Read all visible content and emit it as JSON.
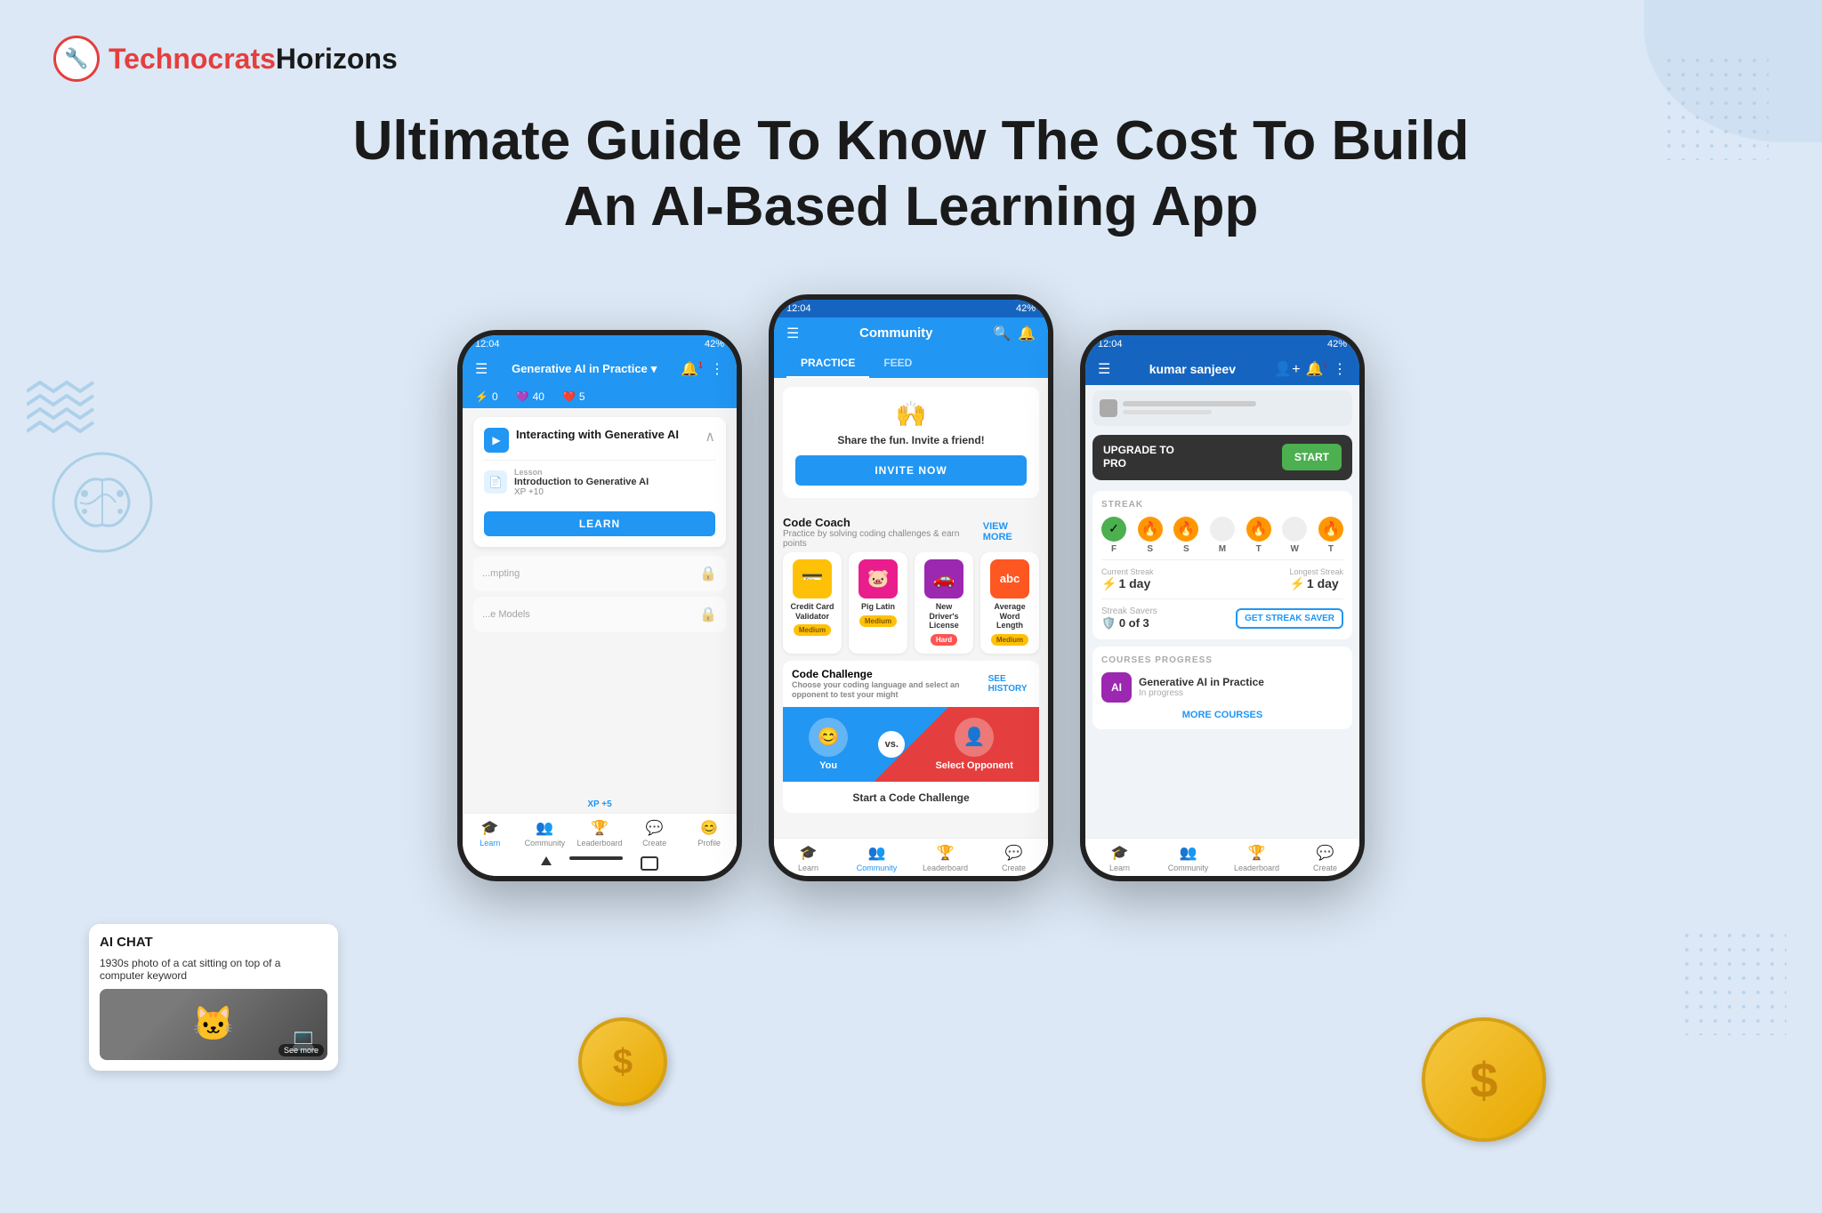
{
  "header": {
    "logo_icon": "🔧",
    "logo_text_red": "Technocrats",
    "logo_text_black": "Horizons"
  },
  "title": {
    "line1": "Ultimate Guide To Know The Cost To Build",
    "line2": "An AI-Based Learning App"
  },
  "phone1": {
    "status_time": "12:04",
    "status_battery": "42%",
    "topbar_title": "Generative AI in Practice",
    "stat_score": "0",
    "stat_hearts": "40",
    "stat_xp": "5",
    "course_title": "Interacting with Generative AI",
    "lesson_label": "Lesson",
    "lesson_name": "Introduction to Generative AI",
    "lesson_xp": "XP +10",
    "learn_btn": "LEARN",
    "nav_items": [
      "Learn",
      "Community",
      "Leaderboard",
      "Create",
      "Profile"
    ]
  },
  "ai_chat": {
    "title": "AI CHAT",
    "query": "1930s photo of a cat sitting on top of a computer keyword",
    "see_more": "See more"
  },
  "phone2": {
    "topbar_title": "Community",
    "tab_practice": "PRACTICE",
    "tab_feed": "FEED",
    "invite_text": "Share the fun. Invite a friend!",
    "invite_btn": "INVITE NOW",
    "code_coach_title": "Code Coach",
    "code_coach_subtitle": "Practice by solving coding challenges & earn points",
    "view_more": "VIEW MORE",
    "challenges": [
      {
        "name": "Credit Card Validator",
        "badge": "Medium",
        "badge_type": "medium",
        "icon": "💳",
        "color": "yellow"
      },
      {
        "name": "Pig Latin",
        "badge": "Medium",
        "badge_type": "medium",
        "icon": "🐷",
        "color": "pink"
      },
      {
        "name": "New Driver's License",
        "badge": "Hard",
        "badge_type": "hard",
        "icon": "🚗",
        "color": "purple"
      },
      {
        "name": "Average Word Length",
        "badge": "Medium",
        "badge_type": "medium",
        "icon": "abc",
        "color": "orange"
      }
    ],
    "code_challenge_title": "Code Challenge",
    "code_challenge_subtitle": "Choose your coding language and select an opponent to test your might",
    "see_history": "SEE HISTORY",
    "player_you": "You",
    "player_opponent": "Select Opponent",
    "start_challenge": "Start a Code Challenge",
    "nav_items": [
      "Learn",
      "Community",
      "Leaderboard",
      "Create"
    ]
  },
  "phone3": {
    "username": "kumar sanjeev",
    "upgrade_text": "UPGRADE TO\nPRO",
    "start_btn": "START",
    "streak_label": "STREAK",
    "days": [
      "F",
      "S",
      "S",
      "M",
      "T",
      "W",
      "T"
    ],
    "day_states": [
      "active",
      "flame",
      "flame",
      "inactive",
      "flame",
      "inactive",
      "flame"
    ],
    "current_streak_label": "Current Streak",
    "current_streak_value": "1 day",
    "longest_streak_label": "Longest Streak",
    "longest_streak_value": "1 day",
    "streak_savers_label": "Streak Savers",
    "streak_savers_value": "0 of 3",
    "get_streak_saver": "GET STREAK SAVER",
    "courses_label": "COURSES PROGRESS",
    "course_name": "Generative AI in Practice",
    "course_status": "In progress",
    "more_courses": "MORE COURSES",
    "nav_items": [
      "Learn",
      "Community",
      "Leaderboard",
      "Create"
    ]
  }
}
